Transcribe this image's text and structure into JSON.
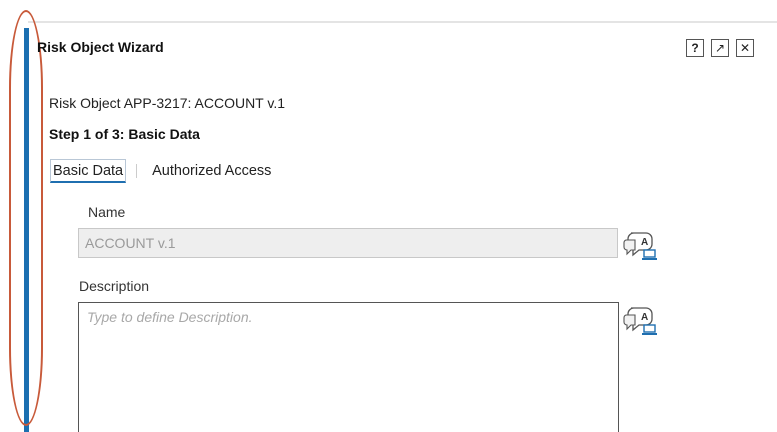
{
  "dialog": {
    "title": "Risk Object Wizard",
    "controls": {
      "help_glyph": "?",
      "expand_glyph": "↗",
      "close_glyph": "✕"
    }
  },
  "object": {
    "line": "Risk Object APP-3217: ACCOUNT v.1"
  },
  "wizard": {
    "step_text": "Step 1 of 3: Basic Data",
    "tabs": [
      {
        "label": "Basic Data",
        "active": true
      },
      {
        "label": "Authorized Access",
        "active": false
      }
    ]
  },
  "form": {
    "name": {
      "label": "Name",
      "value": "ACCOUNT v.1"
    },
    "description": {
      "label": "Description",
      "value": "",
      "placeholder": "Type to define Description."
    }
  },
  "icons": {
    "translation": "translation-icon",
    "help": "help-icon",
    "expand": "expand-icon",
    "close": "close-icon"
  },
  "colors": {
    "accent_bar": "#1b6fb0",
    "annotation_oval": "#c85a3a",
    "active_tab_underline": "#1f6fb0"
  }
}
